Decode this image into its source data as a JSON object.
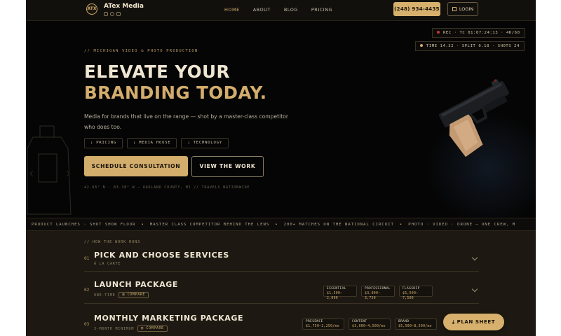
{
  "header": {
    "logo_text": "ATX",
    "brand": "ATex Media",
    "socials": [
      "instagram-icon",
      "google-icon",
      "youtube-icon"
    ],
    "nav": [
      {
        "label": "HOME",
        "active": true
      },
      {
        "label": "ABOUT",
        "active": false
      },
      {
        "label": "BLOG",
        "active": false
      },
      {
        "label": "PRICING",
        "active": false
      }
    ],
    "phone": "(248) 934-4435",
    "login": "LOGIN"
  },
  "hud": {
    "rec": "REC · TC 01:07:24:13 · 4K/60",
    "time": "TIME 14.32 · SPLIT 0.18 · SHOTS 24"
  },
  "hero": {
    "eyebrow": "// MICHIGAN VIDEO & PHOTO PRODUCTION",
    "headline_1": "ELEVATE YOUR",
    "headline_2": "BRANDING TODAY.",
    "subtext": "Media for brands that live on the range — shot by a master-class competitor who does too.",
    "chips": [
      "↓ PRICING",
      "↓ MEDIA HOUSE",
      "↓ TECHNOLOGY"
    ],
    "cta_primary": "SCHEDULE CONSULTATION",
    "cta_secondary": "VIEW THE WORK",
    "coords": "42.66° N · 83.38° W — OAKLAND COUNTY, MI // TRAVELS NATIONWIDE"
  },
  "ticker": {
    "items": [
      "PRODUCT LAUNCHES · SHOT SHOW FLOOR",
      "MASTER CLASS COMPETITOR BEHIND THE LENS",
      "200+ MATCHES ON THE NATIONAL CIRCUIT",
      "PHOTO · VIDEO · DRONE — ONE CREW, M"
    ]
  },
  "services": {
    "eyebrow": "// HOW THE WORK RUNS",
    "rows": [
      {
        "num": "01",
        "title": "PICK AND CHOOSE SERVICES",
        "sub": "À LA CARTE",
        "compare": "",
        "tiers": []
      },
      {
        "num": "02",
        "title": "LAUNCH PACKAGE",
        "sub": "ONE-TIME",
        "compare": "COMPARE",
        "tiers": [
          {
            "name": "ESSENTIAL",
            "price": "$1,500–2,000"
          },
          {
            "name": "PROFESSIONAL",
            "price": "$3,000–3,750"
          },
          {
            "name": "FLAGSHIP",
            "price": "$5,500–7,500"
          }
        ]
      },
      {
        "num": "03",
        "title": "MONTHLY MARKETING PACKAGE",
        "sub": "3-MONTH MINIMUM",
        "compare": "COMPARE",
        "tiers": [
          {
            "name": "PRESENCE",
            "price": "$1,750–2,250/mo"
          },
          {
            "name": "CONTENT",
            "price": "$3,000–4,500/mo"
          },
          {
            "name": "BRAND",
            "price": "$5,500–8,500/mo"
          }
        ]
      }
    ]
  },
  "plan_sheet": "PLAN SHEET",
  "colors": {
    "accent": "#d3ad6c",
    "background": "#0a0908",
    "section": "#1d1912"
  }
}
